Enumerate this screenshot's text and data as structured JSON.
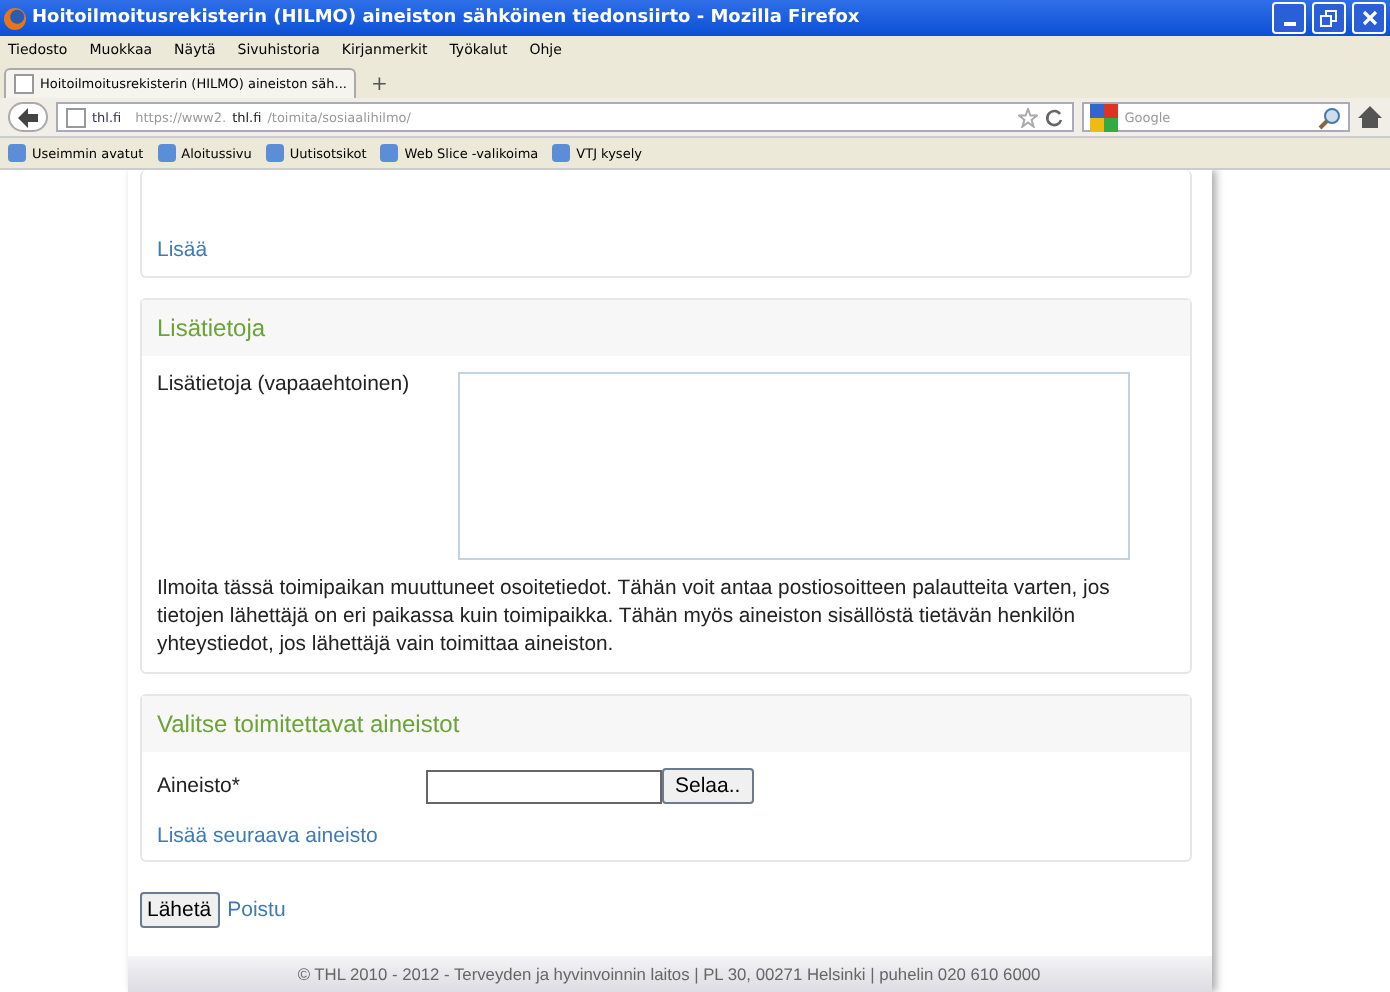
{
  "window": {
    "title": "Hoitoilmoitusrekisterin (HILMO) aineiston sähköinen tiedonsiirto - Mozilla Firefox"
  },
  "menu": [
    "Tiedosto",
    "Muokkaa",
    "Näytä",
    "Sivuhistoria",
    "Kirjanmerkit",
    "Työkalut",
    "Ohje"
  ],
  "tabs": [
    {
      "label": "Hoitoilmoitusrekisterin (HILMO) aineiston säh...",
      "selected": true
    }
  ],
  "new_tab": "+",
  "address_bar": {
    "site": "thl.fi",
    "url_prefix": "https://www2.",
    "url_domain": "thl.fi",
    "url_path": "/toimita/sosiaalihilmo/"
  },
  "search": {
    "placeholder": "Google"
  },
  "bookmarks": [
    "Useimmin avatut",
    "Aloitussivu",
    "Uutisotsikot",
    "Web Slice -valikoima",
    "VTJ kysely"
  ],
  "page": {
    "top_section": {
      "link": "Lisää"
    },
    "info_section": {
      "title": "Lisätietoja",
      "field_label": "Lisätietoja (vapaaehtoinen)",
      "help": "Ilmoita tässä toimipaikan muuttuneet osoitetiedot. Tähän voit antaa postiosoitteen palautteita varten, jos tietojen lähettäjä on eri paikassa kuin toimipaikka. Tähän myös aineiston sisällöstä tietävän henkilön yhteystiedot, jos lähettäjä vain toimittaa aineiston."
    },
    "files_section": {
      "title": "Valitse toimitettavat aineistot",
      "field_label": "Aineisto*",
      "browse_button": "Selaa..",
      "add_link": "Lisää seuraava aineisto"
    },
    "submit_button": "Lähetä",
    "exit_link": "Poistu",
    "footer": "© THL 2010 - 2012 - Terveyden ja hyvinvoinnin laitos | PL 30, 00271 Helsinki | puhelin 020 610 6000"
  }
}
